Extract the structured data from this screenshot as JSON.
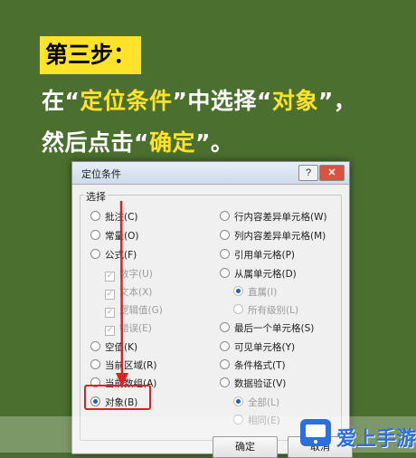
{
  "overlay": {
    "step_label": "第三步：",
    "line1": {
      "p1": "在“",
      "h1": "定位条件",
      "p2": "”中选择“",
      "h2": "对象",
      "p3": "”，"
    },
    "line2": {
      "p1": "然后点击“",
      "h1": "确定",
      "p2": "”。"
    },
    "highlight_color": "#ffe32a"
  },
  "dialog": {
    "title": "定位条件",
    "help": "?",
    "close": "✕",
    "group_label": "选择",
    "left_options": [
      {
        "label": "批注(C)",
        "selected": false,
        "type": "radio",
        "enabled": true
      },
      {
        "label": "常量(O)",
        "selected": false,
        "type": "radio",
        "enabled": true
      },
      {
        "label": "公式(F)",
        "selected": false,
        "type": "radio",
        "enabled": true
      },
      {
        "label": "数字(U)",
        "type": "check",
        "enabled": false
      },
      {
        "label": "文本(X)",
        "type": "check",
        "enabled": false
      },
      {
        "label": "逻辑值(G)",
        "type": "check",
        "enabled": false
      },
      {
        "label": "错误(E)",
        "type": "check",
        "enabled": false
      },
      {
        "label": "空值(K)",
        "selected": false,
        "type": "radio",
        "enabled": true
      },
      {
        "label": "当前区域(R)",
        "selected": false,
        "type": "radio",
        "enabled": true
      },
      {
        "label": "当前数组(A)",
        "selected": false,
        "type": "radio",
        "enabled": true
      },
      {
        "label": "对象(B)",
        "selected": true,
        "type": "radio",
        "enabled": true
      }
    ],
    "right_options": [
      {
        "label": "行内容差异单元格(W)",
        "selected": false,
        "enabled": true
      },
      {
        "label": "列内容差异单元格(M)",
        "selected": false,
        "enabled": true
      },
      {
        "label": "引用单元格(P)",
        "selected": false,
        "enabled": true
      },
      {
        "label": "从属单元格(D)",
        "selected": false,
        "enabled": true
      },
      {
        "label": "直属(I)",
        "selected": true,
        "enabled": false
      },
      {
        "label": "所有级别(L)",
        "selected": false,
        "enabled": false
      },
      {
        "label": "最后一个单元格(S)",
        "selected": false,
        "enabled": true
      },
      {
        "label": "可见单元格(Y)",
        "selected": false,
        "enabled": true
      },
      {
        "label": "条件格式(T)",
        "selected": false,
        "enabled": true
      },
      {
        "label": "数据验证(V)",
        "selected": false,
        "enabled": true
      },
      {
        "label": "全部(L)",
        "selected": true,
        "enabled": false
      },
      {
        "label": "相同(E)",
        "selected": false,
        "enabled": false
      }
    ],
    "ok_label": "确定",
    "cancel_label": "取消"
  },
  "watermark": {
    "text": "爱上手游网"
  },
  "colors": {
    "background": "#4a6f2e",
    "annotation": "#e02020",
    "radio_selected": "#1f5fbf"
  }
}
